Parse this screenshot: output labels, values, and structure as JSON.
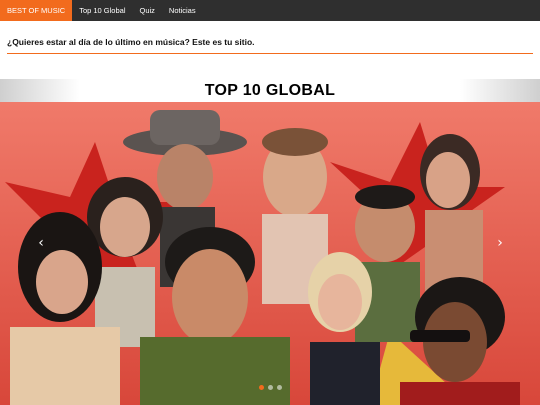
{
  "nav": {
    "brand": "BEST OF MUSIC",
    "items": [
      {
        "label": "Top 10 Global"
      },
      {
        "label": "Quiz"
      },
      {
        "label": "Noticias"
      }
    ]
  },
  "tagline": "¿Quieres estar al día de lo último en música? Este es tu sitio.",
  "section_title": "TOP 10 GLOBAL",
  "slider": {
    "prev_icon": "‹",
    "next_icon": "›",
    "dots": 3,
    "active_dot": 0
  },
  "colors": {
    "brand": "#f26b1d",
    "nav_bg": "#2f2f2f",
    "slide_bg": "#e8604f",
    "star": "#cf2a24"
  }
}
